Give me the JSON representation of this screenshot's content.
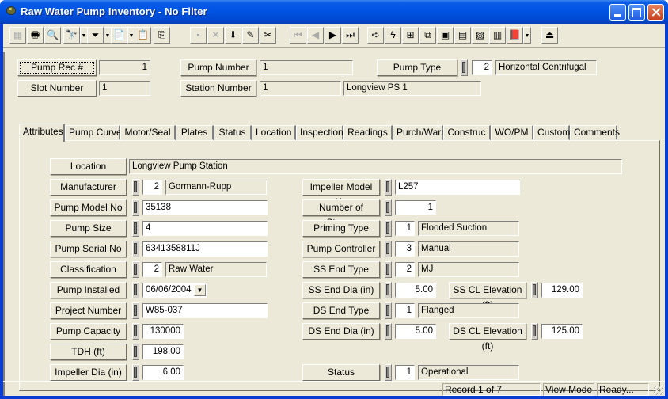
{
  "window": {
    "title": "Raw Water Pump Inventory - No Filter",
    "buttons": {
      "minimize": "minimize",
      "maximize": "maximize",
      "close": "close"
    }
  },
  "toolbar": {
    "buttons": [
      {
        "icon": "form-view-icon",
        "glyph": "▦",
        "enabled": false
      },
      {
        "icon": "print-icon",
        "glyph": "🖶",
        "enabled": true
      },
      {
        "icon": "print-preview-icon",
        "glyph": "🔍",
        "enabled": true
      },
      {
        "icon": "find-icon",
        "glyph": "🔭",
        "enabled": true,
        "dropdown": true
      },
      {
        "icon": "filter-icon",
        "glyph": "⏷",
        "enabled": true,
        "dropdown": true
      },
      {
        "icon": "report-icon",
        "glyph": "📄",
        "enabled": true,
        "dropdown": true
      },
      {
        "icon": "properties-icon",
        "glyph": "📋",
        "enabled": false
      },
      {
        "icon": "export-icon",
        "glyph": "⎘",
        "enabled": true
      },
      {
        "icon": "save-icon",
        "glyph": "▪",
        "enabled": false
      },
      {
        "icon": "delete-icon",
        "glyph": "✕",
        "enabled": false
      },
      {
        "icon": "add-record-icon",
        "glyph": "⬇",
        "enabled": true
      },
      {
        "icon": "edit-icon",
        "glyph": "✎",
        "enabled": true
      },
      {
        "icon": "cut-icon",
        "glyph": "✂",
        "enabled": true
      },
      {
        "icon": "first-record-icon",
        "glyph": "⏮",
        "enabled": false
      },
      {
        "icon": "previous-record-icon",
        "glyph": "◀",
        "enabled": false
      },
      {
        "icon": "next-record-icon",
        "glyph": "▶",
        "enabled": true
      },
      {
        "icon": "last-record-icon",
        "glyph": "⏭",
        "enabled": true
      },
      {
        "icon": "go-to-icon",
        "glyph": "➪",
        "enabled": true
      },
      {
        "icon": "lightning-icon",
        "glyph": "ϟ",
        "enabled": true
      },
      {
        "icon": "hierarchy-icon",
        "glyph": "⊞",
        "enabled": true
      },
      {
        "icon": "relationship-icon",
        "glyph": "⧉",
        "enabled": true
      },
      {
        "icon": "map-icon",
        "glyph": "▣",
        "enabled": true
      },
      {
        "icon": "calculator-icon",
        "glyph": "▤",
        "enabled": true
      },
      {
        "icon": "gis-icon",
        "glyph": "▨",
        "enabled": true
      },
      {
        "icon": "spreadsheet-icon",
        "glyph": "▥",
        "enabled": true
      },
      {
        "icon": "help-book-icon",
        "glyph": "📕",
        "enabled": true,
        "dropdown": true
      },
      {
        "icon": "exit-icon",
        "glyph": "⏏",
        "enabled": true
      }
    ]
  },
  "header": {
    "pump_rec_label": "Pump Rec #",
    "pump_rec_value": "1",
    "pump_number_label": "Pump Number",
    "pump_number_value": "1",
    "pump_type_label": "Pump Type",
    "pump_type_code": "2",
    "pump_type_desc": "Horizontal Centrifugal",
    "slot_number_label": "Slot Number",
    "slot_number_value": "1",
    "station_number_label": "Station Number",
    "station_number_value": "1",
    "station_name": "Longview PS 1"
  },
  "tabs": [
    {
      "label": "Attributes",
      "active": true
    },
    {
      "label": "Pump Curve"
    },
    {
      "label": "Motor/Seal"
    },
    {
      "label": "Plates"
    },
    {
      "label": "Status"
    },
    {
      "label": "Location"
    },
    {
      "label": "Inspections"
    },
    {
      "label": "Readings"
    },
    {
      "label": "Purch/Warr"
    },
    {
      "label": "Construc"
    },
    {
      "label": "WO/PM"
    },
    {
      "label": "Custom"
    },
    {
      "label": "Comments"
    }
  ],
  "attributes": {
    "location": {
      "label": "Location",
      "value": "Longview Pump Station"
    },
    "manufacturer": {
      "label": "Manufacturer",
      "code": "2",
      "desc": "Gormann-Rupp"
    },
    "pump_model_no": {
      "label": "Pump Model No",
      "value": "35138"
    },
    "pump_size": {
      "label": "Pump Size",
      "value": "4"
    },
    "pump_serial_no": {
      "label": "Pump Serial No",
      "value": "6341358811J"
    },
    "classification": {
      "label": "Classification",
      "code": "2",
      "desc": "Raw Water"
    },
    "pump_installed": {
      "label": "Pump Installed",
      "value": "06/06/2004"
    },
    "project_number": {
      "label": "Project Number",
      "value": "W85-037"
    },
    "pump_capacity": {
      "label": "Pump Capacity",
      "value": "130000"
    },
    "tdh": {
      "label": "TDH (ft)",
      "value": "198.00"
    },
    "impeller_dia": {
      "label": "Impeller Dia (in)",
      "value": "6.00"
    },
    "impeller_model_no": {
      "label": "Impeller Model No",
      "value": "L257"
    },
    "number_of_stages": {
      "label": "Number of Stages",
      "value": "1"
    },
    "priming_type": {
      "label": "Priming Type",
      "code": "1",
      "desc": "Flooded Suction"
    },
    "pump_controller": {
      "label": "Pump Controller",
      "code": "3",
      "desc": "Manual"
    },
    "ss_end_type": {
      "label": "SS End Type",
      "code": "2",
      "desc": "MJ"
    },
    "ss_end_dia": {
      "label": "SS End Dia (in)",
      "value": "5.00"
    },
    "ss_cl_elevation": {
      "label": "SS CL Elevation (ft)",
      "value": "129.00"
    },
    "ds_end_type": {
      "label": "DS End Type",
      "code": "1",
      "desc": "Flanged"
    },
    "ds_end_dia": {
      "label": "DS End Dia (in)",
      "value": "5.00"
    },
    "ds_cl_elevation": {
      "label": "DS CL Elevation (ft)",
      "value": "125.00"
    },
    "status": {
      "label": "Status",
      "code": "1",
      "desc": "Operational"
    }
  },
  "statusbar": {
    "record": "Record 1 of 7",
    "mode": "View Mode",
    "state": "Ready..."
  }
}
